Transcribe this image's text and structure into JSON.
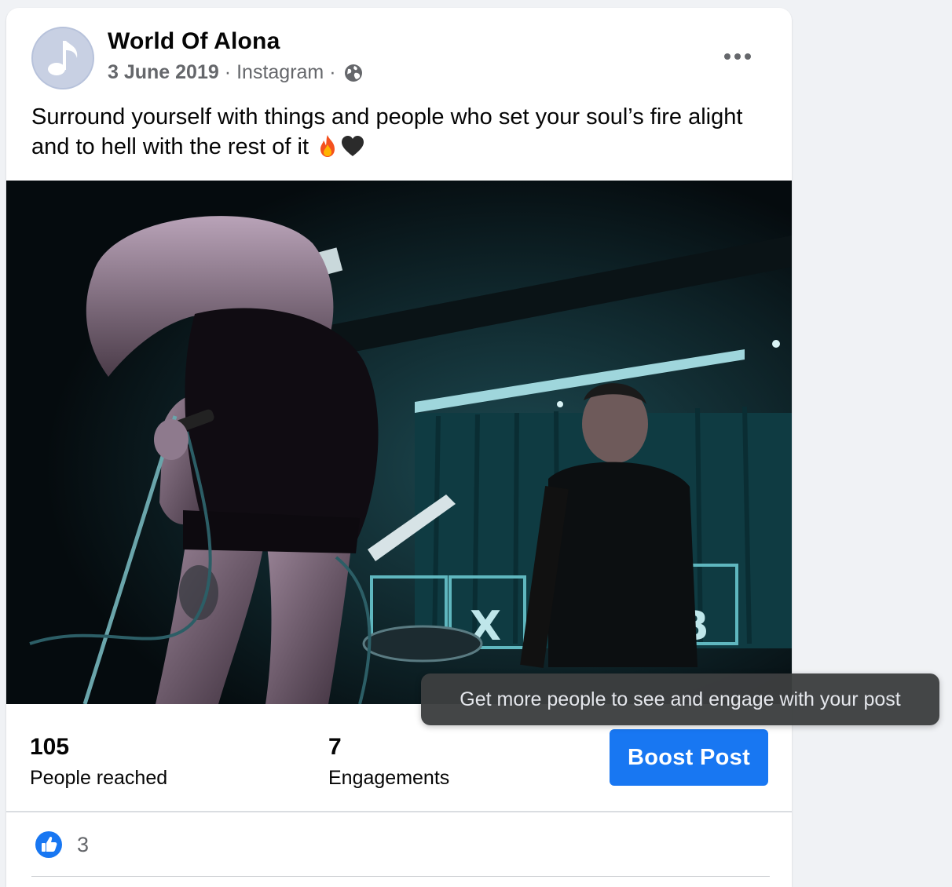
{
  "post": {
    "page_name": "World Of Alona",
    "date": "3 June 2019",
    "source": "Instagram",
    "separator": "·",
    "audience_icon": "globe-icon",
    "text": "Surround yourself with things and people who set your soul’s fire alight and to hell with the rest of it",
    "emojis": [
      "fire-emoji",
      "black-heart-emoji"
    ]
  },
  "image": {
    "alt_semantic": "band-performance-photo"
  },
  "stats": {
    "reached_value": "105",
    "reached_label": "People reached",
    "engagements_value": "7",
    "engagements_label": "Engagements"
  },
  "boost": {
    "label": "Boost Post",
    "tooltip": "Get more people to see and engage with your post"
  },
  "reactions": {
    "icon": "like-icon",
    "count": "3"
  },
  "colors": {
    "accent": "#1877f2",
    "secondary_text": "#65676b",
    "avatar_bg": "#c8d0e3",
    "tooltip_bg": "#3c3e40"
  }
}
